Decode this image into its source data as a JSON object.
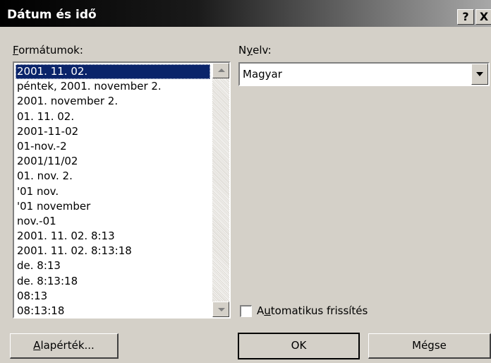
{
  "window": {
    "title": "Dátum és idő",
    "help_label": "?",
    "close_label": "X"
  },
  "formats": {
    "label_accel": "F",
    "label_rest": "ormátumok:",
    "selected_index": 0,
    "items": [
      "2001. 11. 02.",
      "péntek, 2001. november 2.",
      "2001. november 2.",
      "01. 11. 02.",
      "2001-11-02",
      "01-nov.-2",
      "2001/11/02",
      "01. nov. 2.",
      "'01 nov.",
      "'01 november",
      "nov.-01",
      "2001. 11. 02. 8:13",
      "2001. 11. 02. 8:13:18",
      "de. 8:13",
      "de. 8:13:18",
      "08:13",
      "08:13:18"
    ]
  },
  "language": {
    "label_pre": "N",
    "label_accel": "y",
    "label_rest": "elv:",
    "value": "Magyar"
  },
  "auto_update": {
    "checked": false,
    "label_pre": "A",
    "label_accel": "u",
    "label_rest": "tomatikus frissítés"
  },
  "buttons": {
    "default_accel": "A",
    "default_rest": "lapérték...",
    "ok": "OK",
    "cancel": "Mégse"
  },
  "icons": {
    "scroll_up": "scroll-up-arrow-icon",
    "scroll_down": "scroll-down-arrow-icon",
    "dropdown": "chevron-down-icon"
  }
}
